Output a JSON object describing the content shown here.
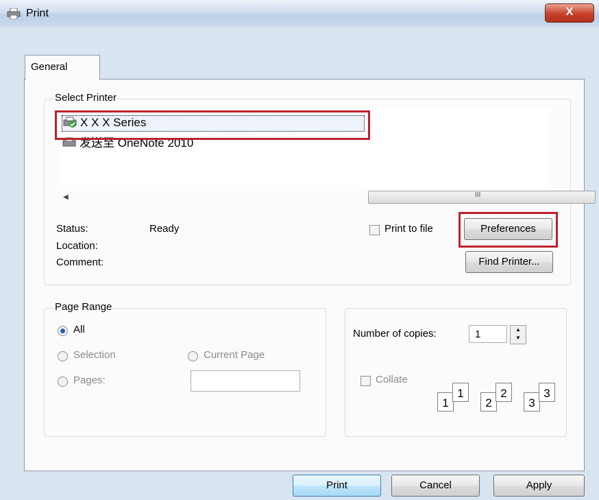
{
  "window": {
    "title": "Print",
    "close_label": "X"
  },
  "tabs": [
    {
      "label": "General"
    }
  ],
  "select_printer": {
    "group_label": "Select Printer",
    "printers": [
      {
        "name": "X X X Series",
        "selected": true
      },
      {
        "name": "发送至 OneNote 2010",
        "selected": false
      }
    ]
  },
  "printer_info": {
    "status_label": "Status:",
    "status_value": "Ready",
    "location_label": "Location:",
    "comment_label": "Comment:",
    "print_to_file_label": "Print to file",
    "print_to_file_checked": false,
    "preferences_label": "Preferences",
    "find_printer_label": "Find Printer...",
    "scroll_grip": "III"
  },
  "page_range": {
    "group_label": "Page Range",
    "all_label": "All",
    "selection_label": "Selection",
    "current_page_label": "Current Page",
    "pages_label": "Pages:",
    "pages_value": ""
  },
  "copies": {
    "number_label": "Number of copies:",
    "number_value": "1",
    "collate_label": "Collate",
    "collate_checked": false,
    "page_icons": [
      "1",
      "1",
      "2",
      "2",
      "3",
      "3"
    ]
  },
  "buttons": {
    "print": "Print",
    "cancel": "Cancel",
    "apply": "Apply"
  },
  "colors": {
    "highlight_border": "#c0202d",
    "accent": "#2a5ea8"
  }
}
